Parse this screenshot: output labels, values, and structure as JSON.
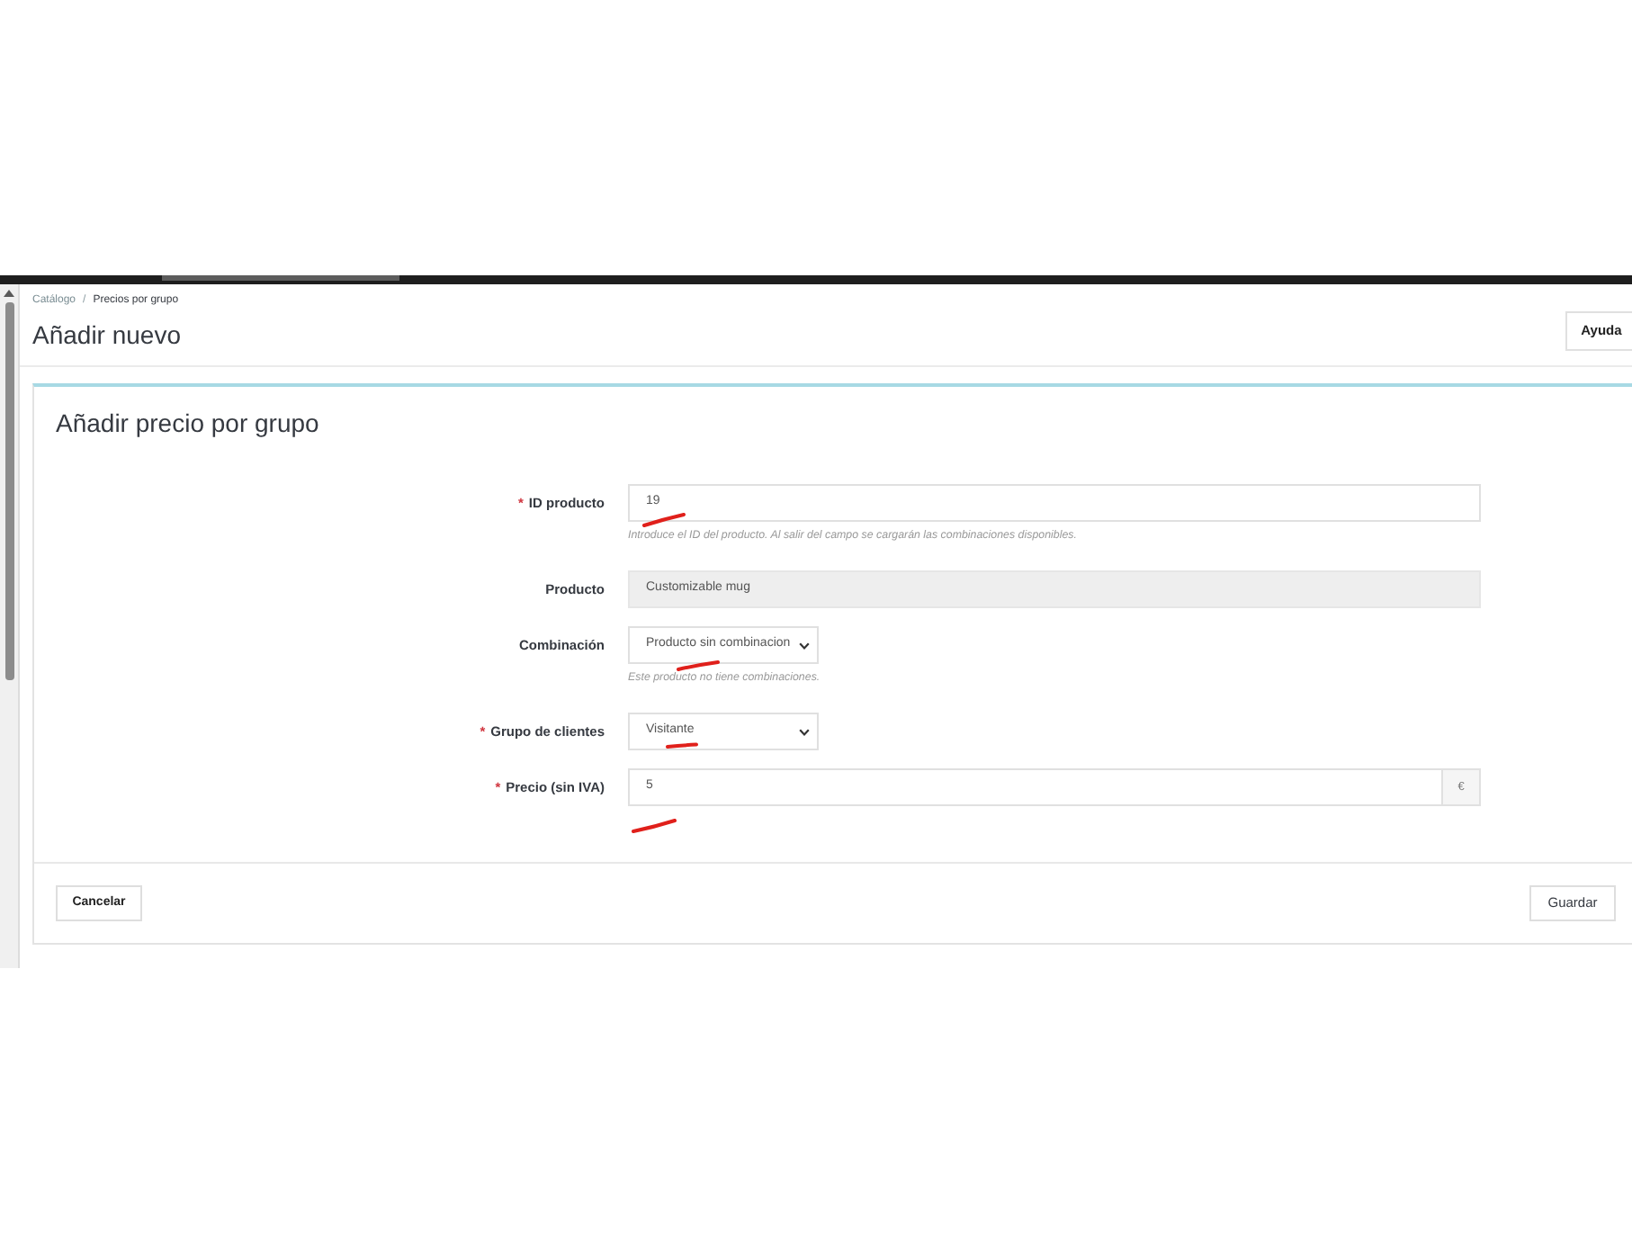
{
  "breadcrumb": {
    "separator": "/",
    "items": [
      {
        "label": "Catálogo",
        "current": false
      },
      {
        "label": "Precios por grupo",
        "current": true
      }
    ]
  },
  "header": {
    "title": "Añadir nuevo",
    "help_button": "Ayuda"
  },
  "form": {
    "title": "Añadir precio por grupo",
    "fields": [
      {
        "kind": "text",
        "required_mark": "*",
        "label": "ID producto",
        "value": "19",
        "disabled": false,
        "help": "Introduce el ID del producto. Al salir del campo se cargarán las combinaciones disponibles."
      },
      {
        "kind": "text",
        "label": "Producto",
        "value": "Customizable mug",
        "disabled": true
      },
      {
        "kind": "select",
        "label": "Combinación",
        "value": "Producto sin combinacion",
        "disabled": false,
        "help": "Este producto no tiene combinaciones."
      },
      {
        "kind": "select",
        "required_mark": "*",
        "label": "Grupo de clientes",
        "value": "Visitante",
        "disabled": false
      },
      {
        "kind": "addon",
        "required_mark": "*",
        "label": "Precio (sin IVA)",
        "value": "5",
        "addon": "€",
        "disabled": false
      }
    ],
    "cancel_button": "Cancelar",
    "save_button": "Guardar"
  }
}
